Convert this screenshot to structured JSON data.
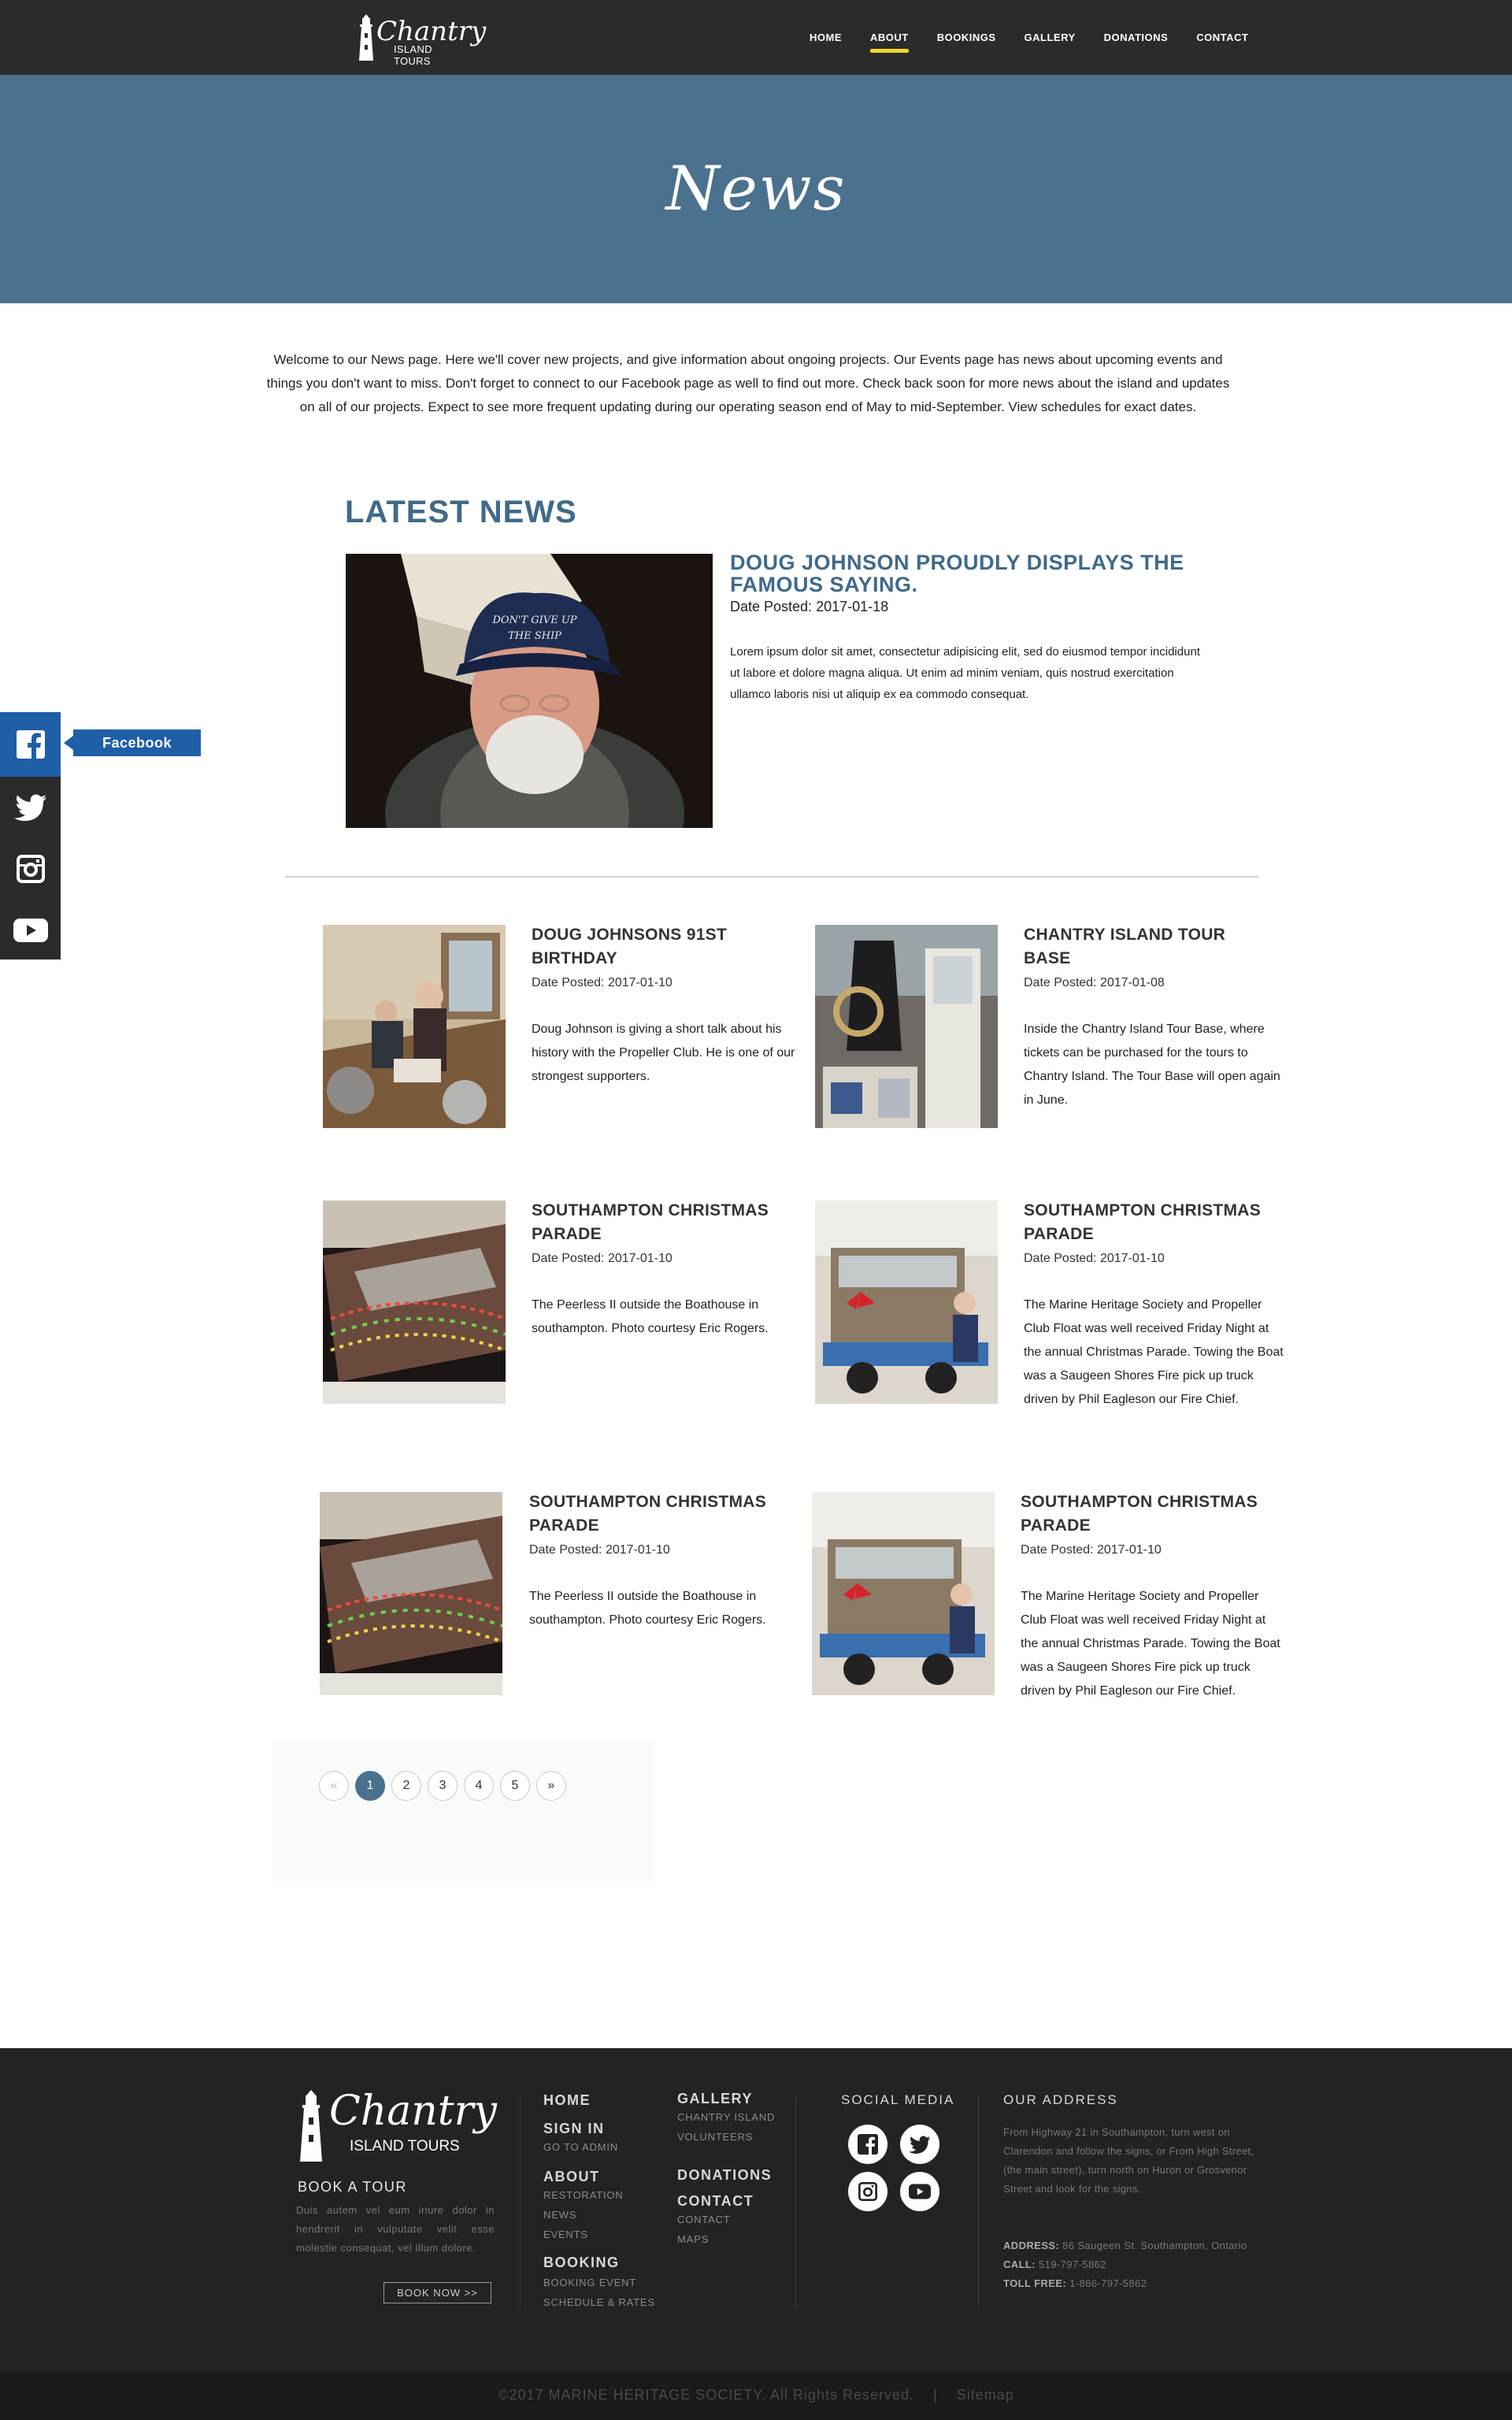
{
  "header": {
    "logo_script": "Chantry",
    "logo_sub": "ISLAND TOURS",
    "nav": [
      {
        "label": "HOME"
      },
      {
        "label": "ABOUT"
      },
      {
        "label": "BOOKINGS"
      },
      {
        "label": "GALLERY"
      },
      {
        "label": "DONATIONS"
      },
      {
        "label": "CONTACT"
      }
    ],
    "active_nav": "ABOUT",
    "accent_color": "#f3d32b"
  },
  "hero": {
    "title": "News",
    "bg_color": "#4a718e"
  },
  "intro": "Welcome to our News page. Here we'll cover new projects, and give information about ongoing projects. Our Events page has news about upcoming events and things you don't want to miss. Don't forget to connect to our Facebook page as well to find out more. Check back soon for more news about the island and updates on all of our projects. Expect to see more frequent updating during our operating season end of May to mid-September. View schedules for exact dates.",
  "latest": {
    "heading": "LATEST NEWS",
    "featured": {
      "title": "DOUG JOHNSON PROUDLY DISPLAYS THE FAMOUS SAYING.",
      "date": "Date Posted: 2017-01-18",
      "body": "Lorem ipsum dolor sit amet, consectetur adipisicing elit, sed do eiusmod tempor incididunt ut labore et dolore magna aliqua. Ut enim ad minim veniam, quis nostrud exercitation ullamco laboris nisi ut aliquip ex ea commodo consequat.",
      "cap_text_1": "DON'T GIVE UP",
      "cap_text_2": "THE SHIP"
    }
  },
  "posts": [
    {
      "title": "DOUG JOHNSONS 91ST BIRTHDAY",
      "date": "Date Posted: 2017-01-10",
      "body": "Doug Johnson is giving a short talk about his history with the Propeller Club. He is one of our strongest supporters."
    },
    {
      "title": "CHANTRY ISLAND TOUR BASE",
      "date": "Date Posted: 2017-01-08",
      "body": "Inside the Chantry Island Tour Base, where tickets can be purchased for the tours to Chantry Island. The Tour Base will open again in June."
    },
    {
      "title": "SOUTHAMPTON CHRISTMAS PARADE",
      "date": "Date Posted: 2017-01-10",
      "body": "The Peerless II outside the Boathouse in southampton. Photo courtesy Eric Rogers."
    },
    {
      "title": "SOUTHAMPTON CHRISTMAS PARADE",
      "date": "Date Posted: 2017-01-10",
      "body": "The Marine Heritage Society and Propeller Club Float was well received Friday Night at the annual Christmas Parade. Towing the Boat was a Saugeen Shores Fire pick up truck driven by Phil Eagleson our Fire Chief."
    },
    {
      "title": "SOUTHAMPTON CHRISTMAS PARADE",
      "date": "Date Posted: 2017-01-10",
      "body": "The Peerless II outside the Boathouse in southampton. Photo courtesy Eric Rogers."
    },
    {
      "title": "SOUTHAMPTON CHRISTMAS PARADE",
      "date": "Date Posted: 2017-01-10",
      "body": "The Marine Heritage Society and Propeller Club Float was well received Friday Night at the annual Christmas Parade. Towing the Boat was a Saugeen Shores Fire pick up truck driven by Phil Eagleson our Fire Chief."
    }
  ],
  "pagination": {
    "prev": "«",
    "pages": [
      "1",
      "2",
      "3",
      "4",
      "5"
    ],
    "next": "»",
    "current": "1"
  },
  "social_sidebar": {
    "facebook_label": "Facebook",
    "items": [
      "facebook-icon",
      "twitter-icon",
      "instagram-icon",
      "youtube-icon"
    ],
    "facebook_color": "#1f5fa8"
  },
  "footer": {
    "logo_script": "Chantry",
    "logo_sub": "ISLAND TOURS",
    "book_title": "BOOK A TOUR",
    "book_text": "Duis autem vel eum iriure dolor in hendrerit in vulputate velit esse molestie consequat, vel illum dolore.",
    "book_button": "BOOK NOW >>",
    "col1": {
      "home": "HOME",
      "signin": "SIGN IN",
      "signin_links": [
        "GO TO ADMIN"
      ],
      "about": "ABOUT",
      "about_links": [
        "RESTORATION",
        "NEWS",
        "EVENTS"
      ],
      "booking": "BOOKING",
      "booking_links": [
        "BOOKING EVENT",
        "SCHEDULE & RATES"
      ]
    },
    "col2": {
      "gallery": "GALLERY",
      "gallery_links": [
        "CHANTRY ISLAND",
        "VOLUNTEERS"
      ],
      "donations": "DONATIONS",
      "contact": "CONTACT",
      "contact_links": [
        "CONTACT",
        "MAPS"
      ]
    },
    "social_title": "SOCIAL MEDIA",
    "social_icons": [
      "facebook-icon",
      "twitter-icon",
      "instagram-icon",
      "youtube-icon"
    ],
    "address_title": "OUR ADDRESS",
    "address_text": "From Highway 21 in Southampton, turn west on Clarendon and follow the signs, or From High Street, (the main street), turn north on Huron or Grosvenor Street and look for the signs.",
    "address_label": "ADDRESS:",
    "address_value": " 86 Saugeen St. Southampton, Ontario",
    "call_label": "CALL:",
    "call_value": " 519-797-5862",
    "tollfree_label": "TOLL FREE:",
    "tollfree_value": "  1-866-797-5862"
  },
  "bottom": {
    "copyright": "©2017 MARINE HERITAGE SOCIETY. All Rights Reserved.",
    "separator": "|",
    "sitemap": "Sitemap"
  }
}
